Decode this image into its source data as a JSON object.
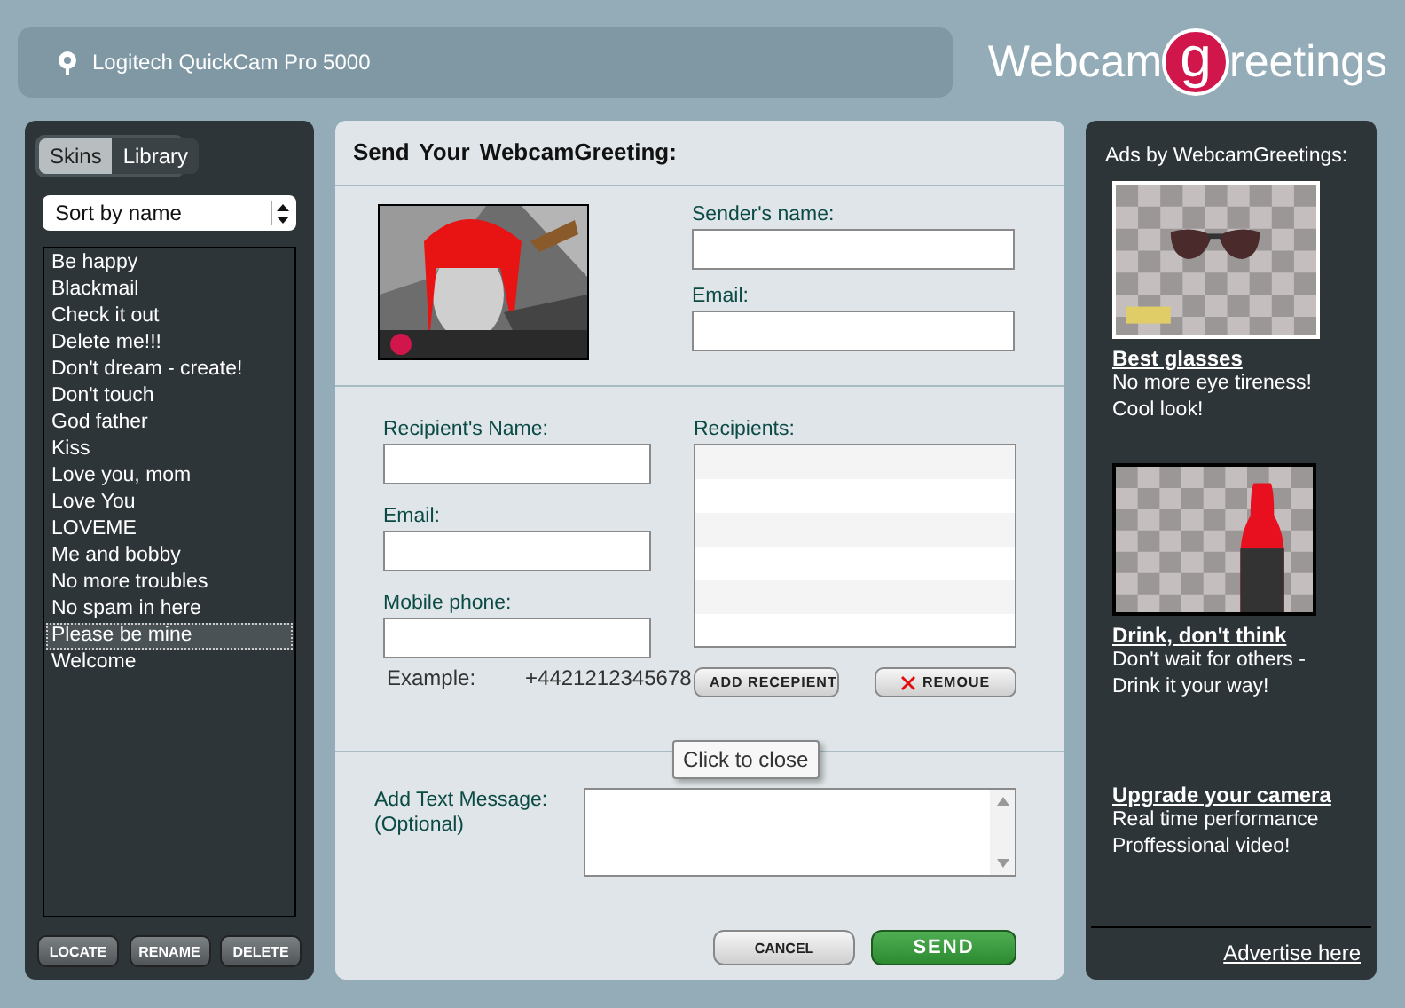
{
  "device": {
    "name": "Logitech QuickCam Pro 5000"
  },
  "logo": {
    "before": "Webcam",
    "badge": "g",
    "after": "reetings"
  },
  "sidebar": {
    "tabs": [
      {
        "label": "Skins",
        "selected": false
      },
      {
        "label": "Library",
        "selected": true
      }
    ],
    "sort": {
      "value": "Sort by name"
    },
    "items": [
      {
        "label": "Be happy",
        "selected": false
      },
      {
        "label": "Blackmail",
        "selected": false
      },
      {
        "label": "Check it out",
        "selected": false
      },
      {
        "label": "Delete me!!!",
        "selected": false
      },
      {
        "label": "Don't dream - create!",
        "selected": false
      },
      {
        "label": "Don't touch",
        "selected": false
      },
      {
        "label": "God father",
        "selected": false
      },
      {
        "label": "Kiss",
        "selected": false
      },
      {
        "label": "Love you, mom",
        "selected": false
      },
      {
        "label": "Love You",
        "selected": false
      },
      {
        "label": "LOVEME",
        "selected": false
      },
      {
        "label": "Me and bobby",
        "selected": false
      },
      {
        "label": "No more troubles",
        "selected": false
      },
      {
        "label": "No spam in here",
        "selected": false
      },
      {
        "label": "Please be mine",
        "selected": true
      },
      {
        "label": "Welcome",
        "selected": false
      }
    ],
    "buttons": [
      "LOCATE",
      "RENAME",
      "DELETE"
    ]
  },
  "form": {
    "title": "Send Your WebcamGreeting:",
    "preview": {
      "kind": "picture"
    },
    "sender_fields": [
      {
        "label": "Sender's name:"
      },
      {
        "label": "Email:"
      }
    ],
    "recipient_fields": [
      {
        "label": "Recipient's Name:"
      },
      {
        "label": "Email:"
      },
      {
        "label": "Mobile phone:"
      }
    ],
    "example": {
      "label": "Example:",
      "value": "+4421212345678"
    },
    "recipients": {
      "label": "Recipients:"
    },
    "recipient_buttons": [
      {
        "label": "ADD RECEPIENT",
        "kind": "add"
      },
      {
        "label": "REMOUE",
        "kind": "remove"
      }
    ],
    "message": {
      "label": "Add Text Message:",
      "note": "(Optional)"
    },
    "tooltip": {
      "text": "Click to close"
    },
    "actions": [
      {
        "label": "CANCEL",
        "kind": "secondary"
      },
      {
        "label": "SEND",
        "kind": "primary"
      }
    ]
  },
  "ads": {
    "title": "Ads by WebcamGreetings:",
    "items": [
      {
        "picture": {
          "kind": "picture"
        },
        "headline": "Best glasses",
        "lines": [
          "No more eye tireness!",
          "Cool look!"
        ]
      },
      {
        "picture": {
          "kind": "picture"
        },
        "headline": "Drink, don't think",
        "lines": [
          "Don't wait for others -",
          "Drink it your way!"
        ]
      },
      {
        "headline": "Upgrade your camera",
        "lines": [
          "Real time performance",
          "Proffessional video!"
        ]
      }
    ],
    "footer_link": "Advertise here"
  }
}
